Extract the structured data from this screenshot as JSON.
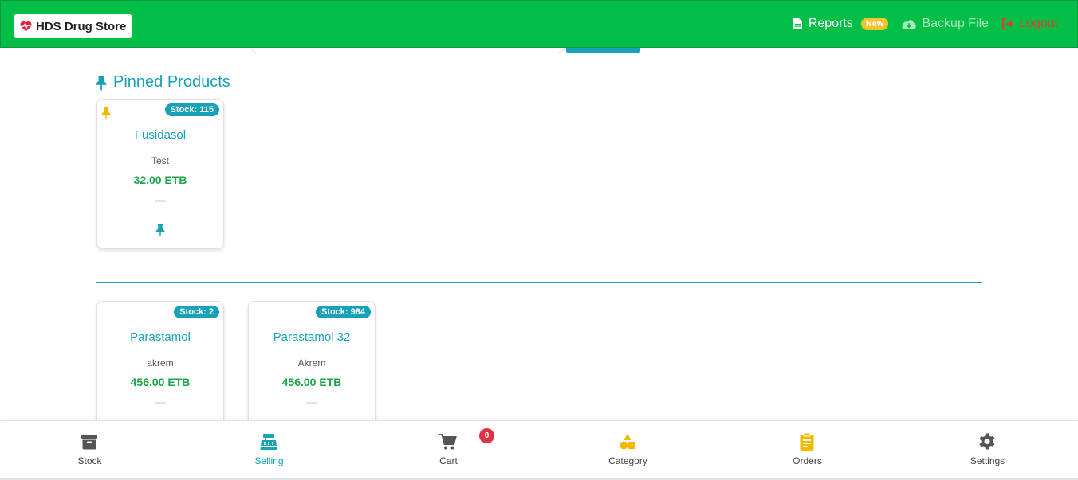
{
  "navbar": {
    "brand": "HDS Drug Store",
    "reports_label": "Reports",
    "reports_badge": "New",
    "backup_label": "Backup File",
    "logout_label": "Logout"
  },
  "pinned": {
    "title": "Pinned Products",
    "products": [
      {
        "stock": "Stock: 115",
        "name": "Fusidasol",
        "sub": "Test",
        "price": "32.00 ETB"
      }
    ]
  },
  "products": [
    {
      "stock": "Stock: 2",
      "name": "Parastamol",
      "sub": "akrem",
      "price": "456.00 ETB"
    },
    {
      "stock": "Stock: 984",
      "name": "Parastamol 32",
      "sub": "Akrem",
      "price": "456.00 ETB"
    }
  ],
  "bottom_nav": {
    "items": [
      {
        "label": "Stock",
        "icon": "archive-icon"
      },
      {
        "label": "Selling",
        "icon": "cash-register-icon",
        "active": true
      },
      {
        "label": "Cart",
        "icon": "cart-icon",
        "badge": "0"
      },
      {
        "label": "Category",
        "icon": "shapes-icon"
      },
      {
        "label": "Orders",
        "icon": "clipboard-icon"
      },
      {
        "label": "Settings",
        "icon": "gear-icon"
      }
    ]
  },
  "colors": {
    "navbar": "#03bf48",
    "accent": "#17a2b8",
    "price": "#1aa64a",
    "badge_new": "#f7c32b",
    "logout": "#e33b2e",
    "cart_badge": "#dc3545"
  }
}
